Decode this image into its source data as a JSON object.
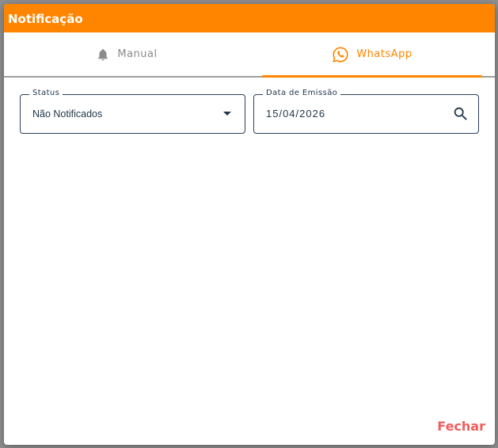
{
  "dialog": {
    "title": "Notificação",
    "close_label": "Fechar"
  },
  "tabs": [
    {
      "label": "Manual",
      "icon": "bell-icon",
      "active": false
    },
    {
      "label": "WhatsApp",
      "icon": "whatsapp-icon",
      "active": true
    }
  ],
  "filters": {
    "status": {
      "label": "Status",
      "value": "Não Notificados"
    },
    "date": {
      "label": "Data de Emissão",
      "value": "15/04/2026"
    }
  },
  "colors": {
    "accent": "#ff8500",
    "text": "#23374a",
    "inactive_tab": "#8a8a8a",
    "close": "#f25c5c"
  }
}
